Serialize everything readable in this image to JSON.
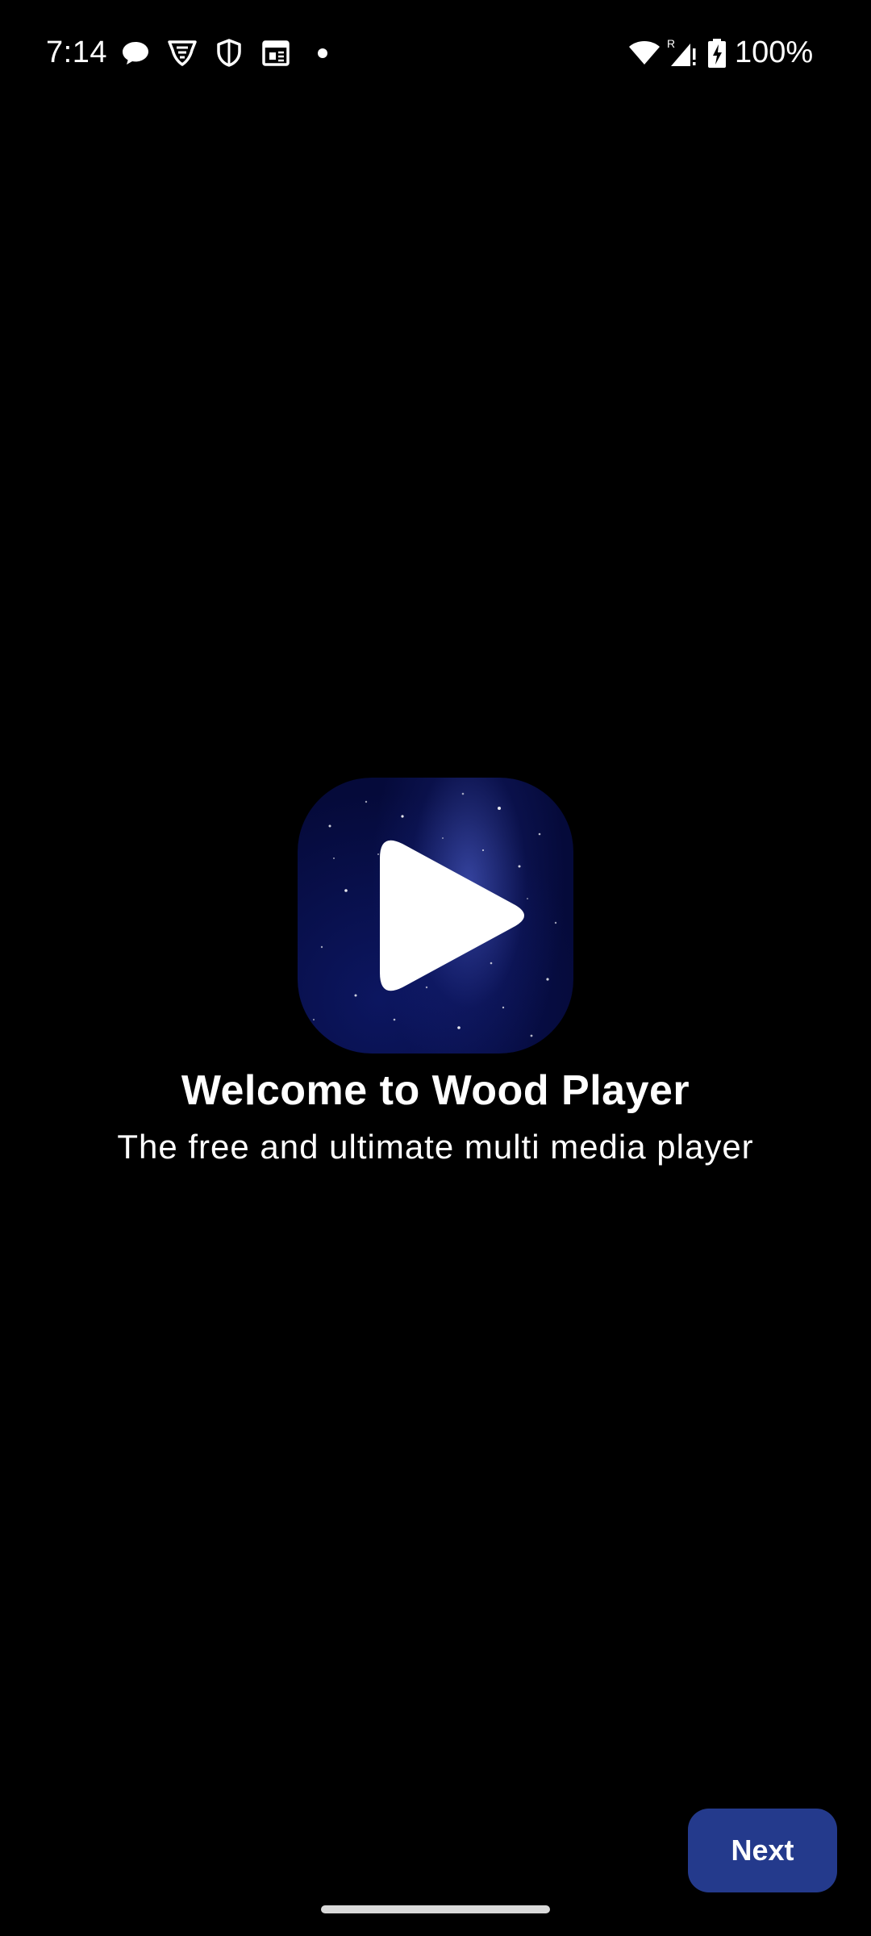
{
  "status_bar": {
    "time": "7:14",
    "battery_percent": "100%",
    "notification_icons": [
      "chat-bubble-icon",
      "vpn-shield-icon",
      "security-shield-icon",
      "calendar-icon"
    ],
    "system_icons": [
      "wifi-icon",
      "cellular-roaming-icon",
      "battery-charging-icon"
    ]
  },
  "welcome": {
    "title": "Welcome to Wood Player",
    "subtitle": "The free and ultimate multi media player"
  },
  "actions": {
    "next_label": "Next"
  },
  "colors": {
    "background": "#000000",
    "next_button": "#243a8c",
    "logo_background": "#071049",
    "text": "#ffffff"
  },
  "app_logo": {
    "icon": "play-icon"
  }
}
